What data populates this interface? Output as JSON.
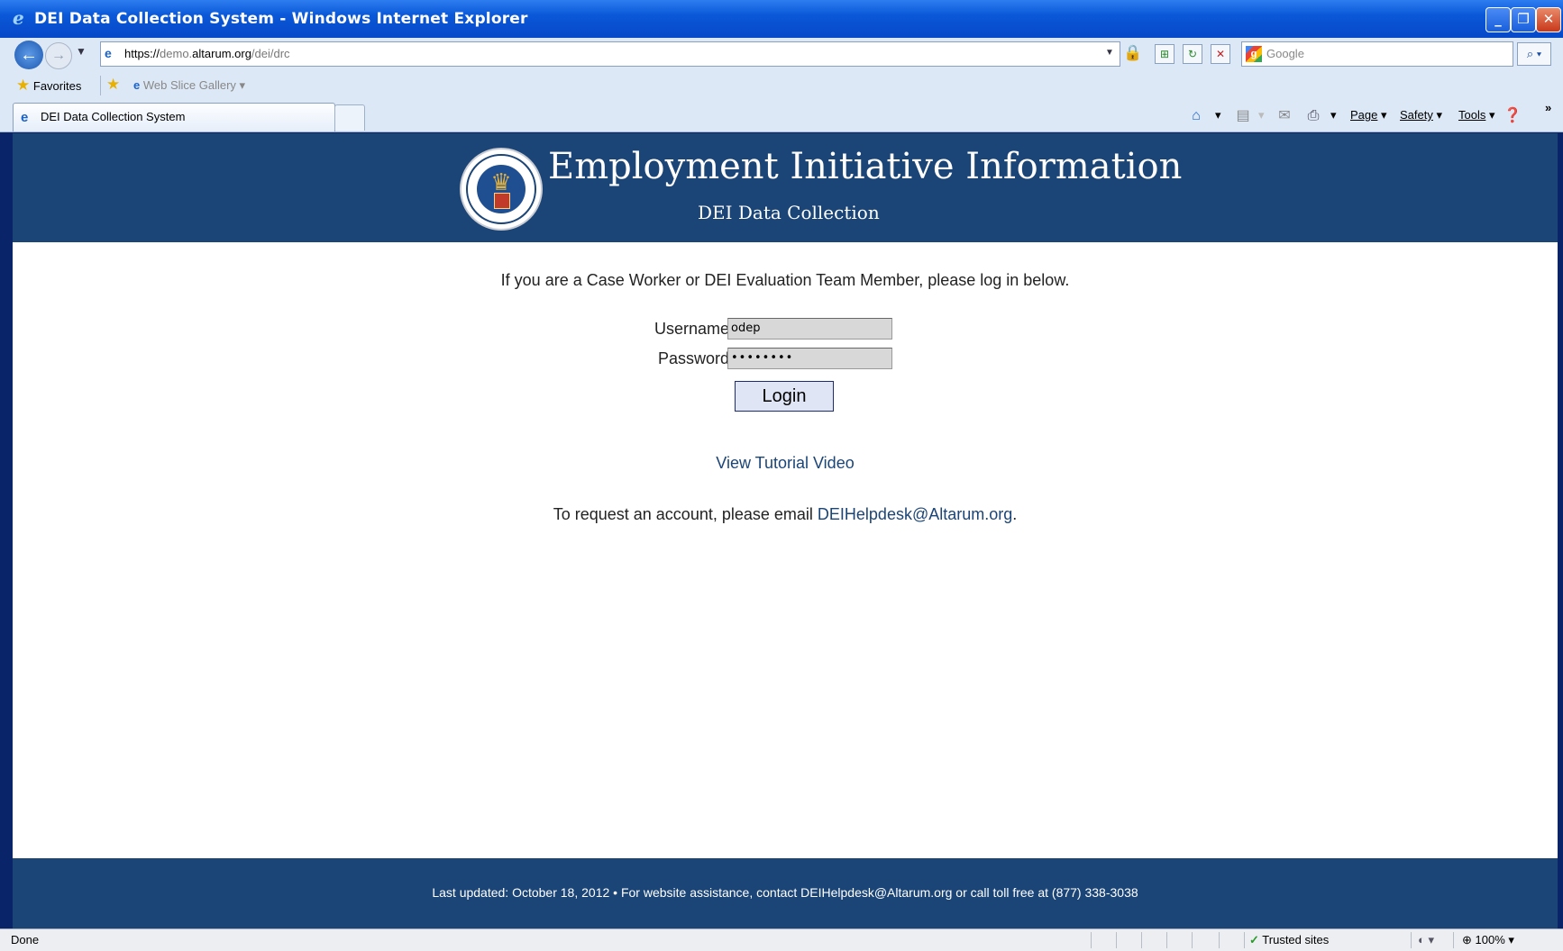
{
  "window": {
    "title": "DEI Data Collection System - Windows Internet Explorer"
  },
  "address_bar": {
    "url_prefix": "https://",
    "url_domain_dim": "demo.",
    "url_domain": "altarum.org",
    "url_path": "/dei/drc"
  },
  "search_box": {
    "placeholder": "Google"
  },
  "favorites_bar": {
    "favorites_label": "Favorites",
    "web_slice_label": "Web Slice Gallery"
  },
  "tabs": [
    {
      "label": "DEI Data Collection System"
    }
  ],
  "command_bar": {
    "page_label": "Page",
    "safety_label": "Safety",
    "tools_label": "Tools"
  },
  "page": {
    "site_title": "Employment Initiative Information",
    "site_subtitle": "DEI Data Collection",
    "intro_text": "If you are a Case Worker or DEI Evaluation Team Member, please log in below.",
    "username_label": "Username:",
    "username_value": "odep",
    "password_label": "Password:",
    "password_value": "••••••••",
    "login_label": "Login",
    "tutorial_link": "View Tutorial Video",
    "request_text": "To request an account, please email ",
    "request_email": "DEIHelpdesk@Altarum.org",
    "request_end": ".",
    "footer_text": "Last updated: October 18, 2012 • For website assistance, contact DEIHelpdesk@Altarum.org or call toll free at (877) 338-3038"
  },
  "status_bar": {
    "status_text": "Done",
    "zone_text": "Trusted sites",
    "zoom_text": "100%"
  },
  "colors": {
    "banner": "#1b4577",
    "link": "#1b4577"
  }
}
